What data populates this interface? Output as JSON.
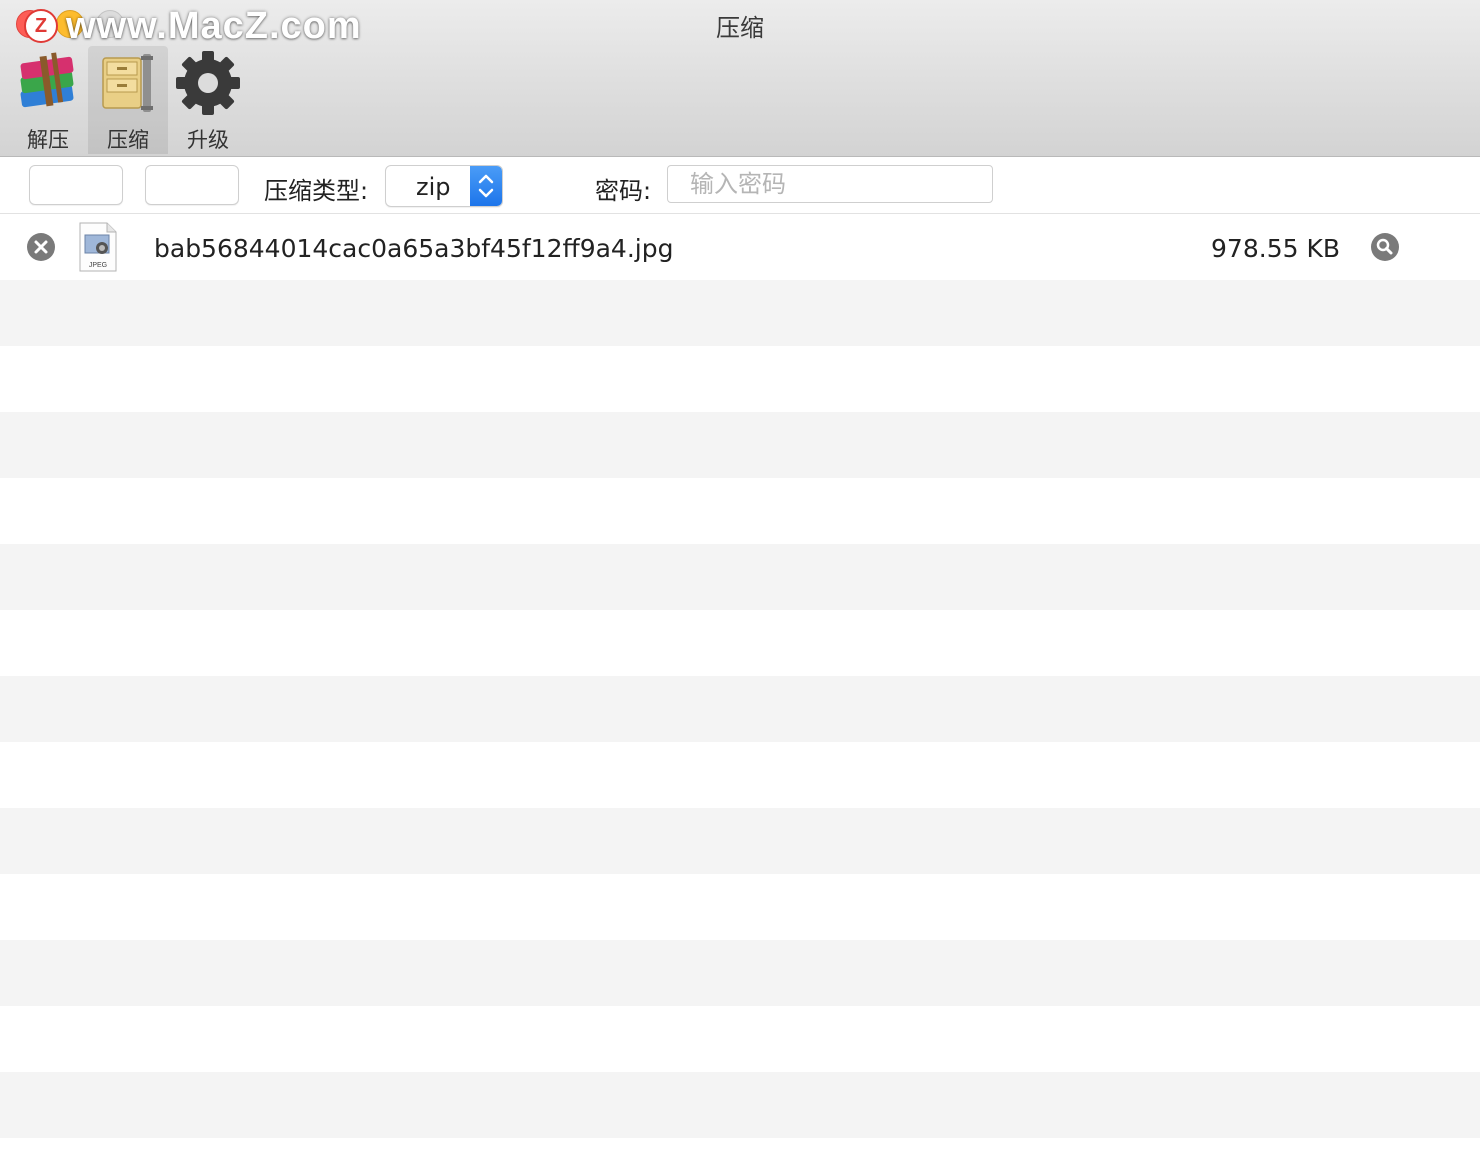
{
  "window": {
    "title": "压缩",
    "watermark_text": "www.MacZ.com",
    "watermark_badge": "Z"
  },
  "toolbar": {
    "items": [
      {
        "label": "解压",
        "icon": "rar-books-icon",
        "active": false
      },
      {
        "label": "压缩",
        "icon": "archive-cabinet-icon",
        "active": true
      },
      {
        "label": "升级",
        "icon": "gear-icon",
        "active": false
      }
    ]
  },
  "options": {
    "type_label": "压缩类型:",
    "type_value": "zip",
    "password_label": "密码:",
    "password_placeholder": "输入密码",
    "password_value": ""
  },
  "files": [
    {
      "name": "bab56844014cac0a65a3bf45f12ff9a4.jpg",
      "size": "978.55 KB",
      "icon": "jpeg-file-icon",
      "icon_text": "JPEG"
    }
  ],
  "colors": {
    "accent": "#1d75ea",
    "stripe": "#f4f4f4"
  }
}
